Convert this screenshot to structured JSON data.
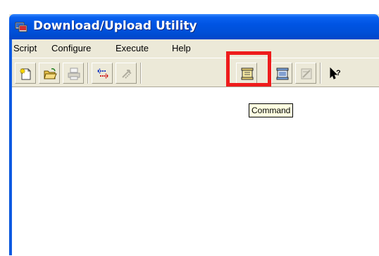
{
  "window": {
    "title": "Download/Upload Utility"
  },
  "menu": {
    "items": [
      "Script",
      "Configure",
      "Execute",
      "Help"
    ]
  },
  "toolbar": {
    "buttons": [
      {
        "icon": "new-script-icon"
      },
      {
        "icon": "open-folder-icon"
      },
      {
        "icon": "print-icon",
        "disabled": true
      },
      {
        "icon": "transfer-icon"
      },
      {
        "icon": "transfer-disabled-icon",
        "disabled": true
      },
      {
        "icon": "command-icon",
        "highlighted": true
      },
      {
        "icon": "command-list-icon"
      },
      {
        "icon": "edit-disabled-icon",
        "disabled": true
      },
      {
        "icon": "help-cursor-icon"
      }
    ]
  },
  "tooltip": {
    "text": "Command"
  },
  "colors": {
    "highlight": "#ee1c1c",
    "titlebar": "#0054e3",
    "tooltip_bg": "#ffffe1"
  }
}
